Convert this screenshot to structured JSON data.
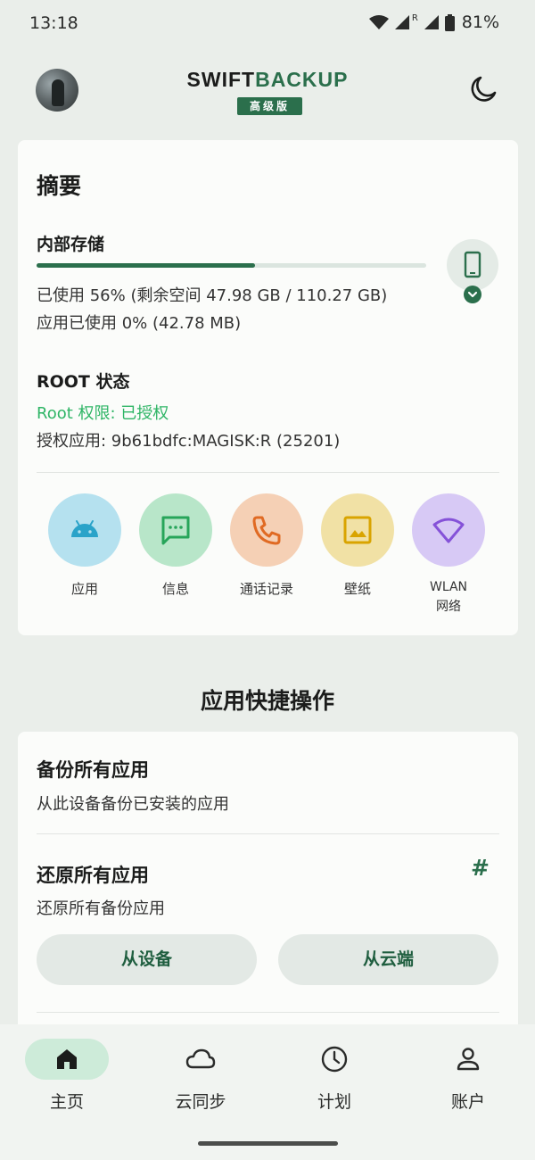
{
  "status_bar": {
    "time": "13:18",
    "battery": "81%",
    "network_badge": "R"
  },
  "header": {
    "brand_part1": "SWIFT",
    "brand_part2": "BACKUP",
    "badge": "高级版"
  },
  "summary": {
    "title": "摘要",
    "storage": {
      "title": "内部存储",
      "used_fraction": 0.56,
      "line1": "已使用 56% (剩余空间 47.98 GB / 110.27 GB)",
      "line2": "应用已使用 0% (42.78 MB)"
    },
    "root": {
      "title": "ROOT 状态",
      "status": "Root 权限: 已授权",
      "app": "授权应用: 9b61bdfc:MAGISK:R (25201)"
    },
    "categories": [
      {
        "label": "应用",
        "bg": "#b5e1ef",
        "fg": "#2aa3c9",
        "icon": "android-icon"
      },
      {
        "label": "信息",
        "bg": "#b8e6c9",
        "fg": "#27a55a",
        "icon": "message-icon"
      },
      {
        "label": "通话记录",
        "bg": "#f5d0b5",
        "fg": "#e06a23",
        "icon": "phone-icon"
      },
      {
        "label": "壁纸",
        "bg": "#f1e1a5",
        "fg": "#d9a400",
        "icon": "image-icon"
      },
      {
        "label": "WLAN\n网络",
        "bg": "#d7c9f5",
        "fg": "#8552d8",
        "icon": "wifi-icon"
      }
    ]
  },
  "quick_actions": {
    "title": "应用快捷操作",
    "backup_title": "备份所有应用",
    "backup_sub": "从此设备备份已安装的应用",
    "restore_title": "还原所有应用",
    "restore_sub": "还原所有备份应用",
    "hash": "#",
    "from_device": "从设备",
    "from_cloud": "从云端"
  },
  "nav": {
    "items": [
      {
        "label": "主页",
        "icon": "home-icon",
        "active": true
      },
      {
        "label": "云同步",
        "icon": "cloud-icon",
        "active": false
      },
      {
        "label": "计划",
        "icon": "clock-icon",
        "active": false
      },
      {
        "label": "账户",
        "icon": "person-icon",
        "active": false
      }
    ]
  },
  "colors": {
    "accent": "#2b6f4c",
    "root_ok": "#2fb566",
    "background": "#eaeeea",
    "card": "#fbfcfa"
  }
}
